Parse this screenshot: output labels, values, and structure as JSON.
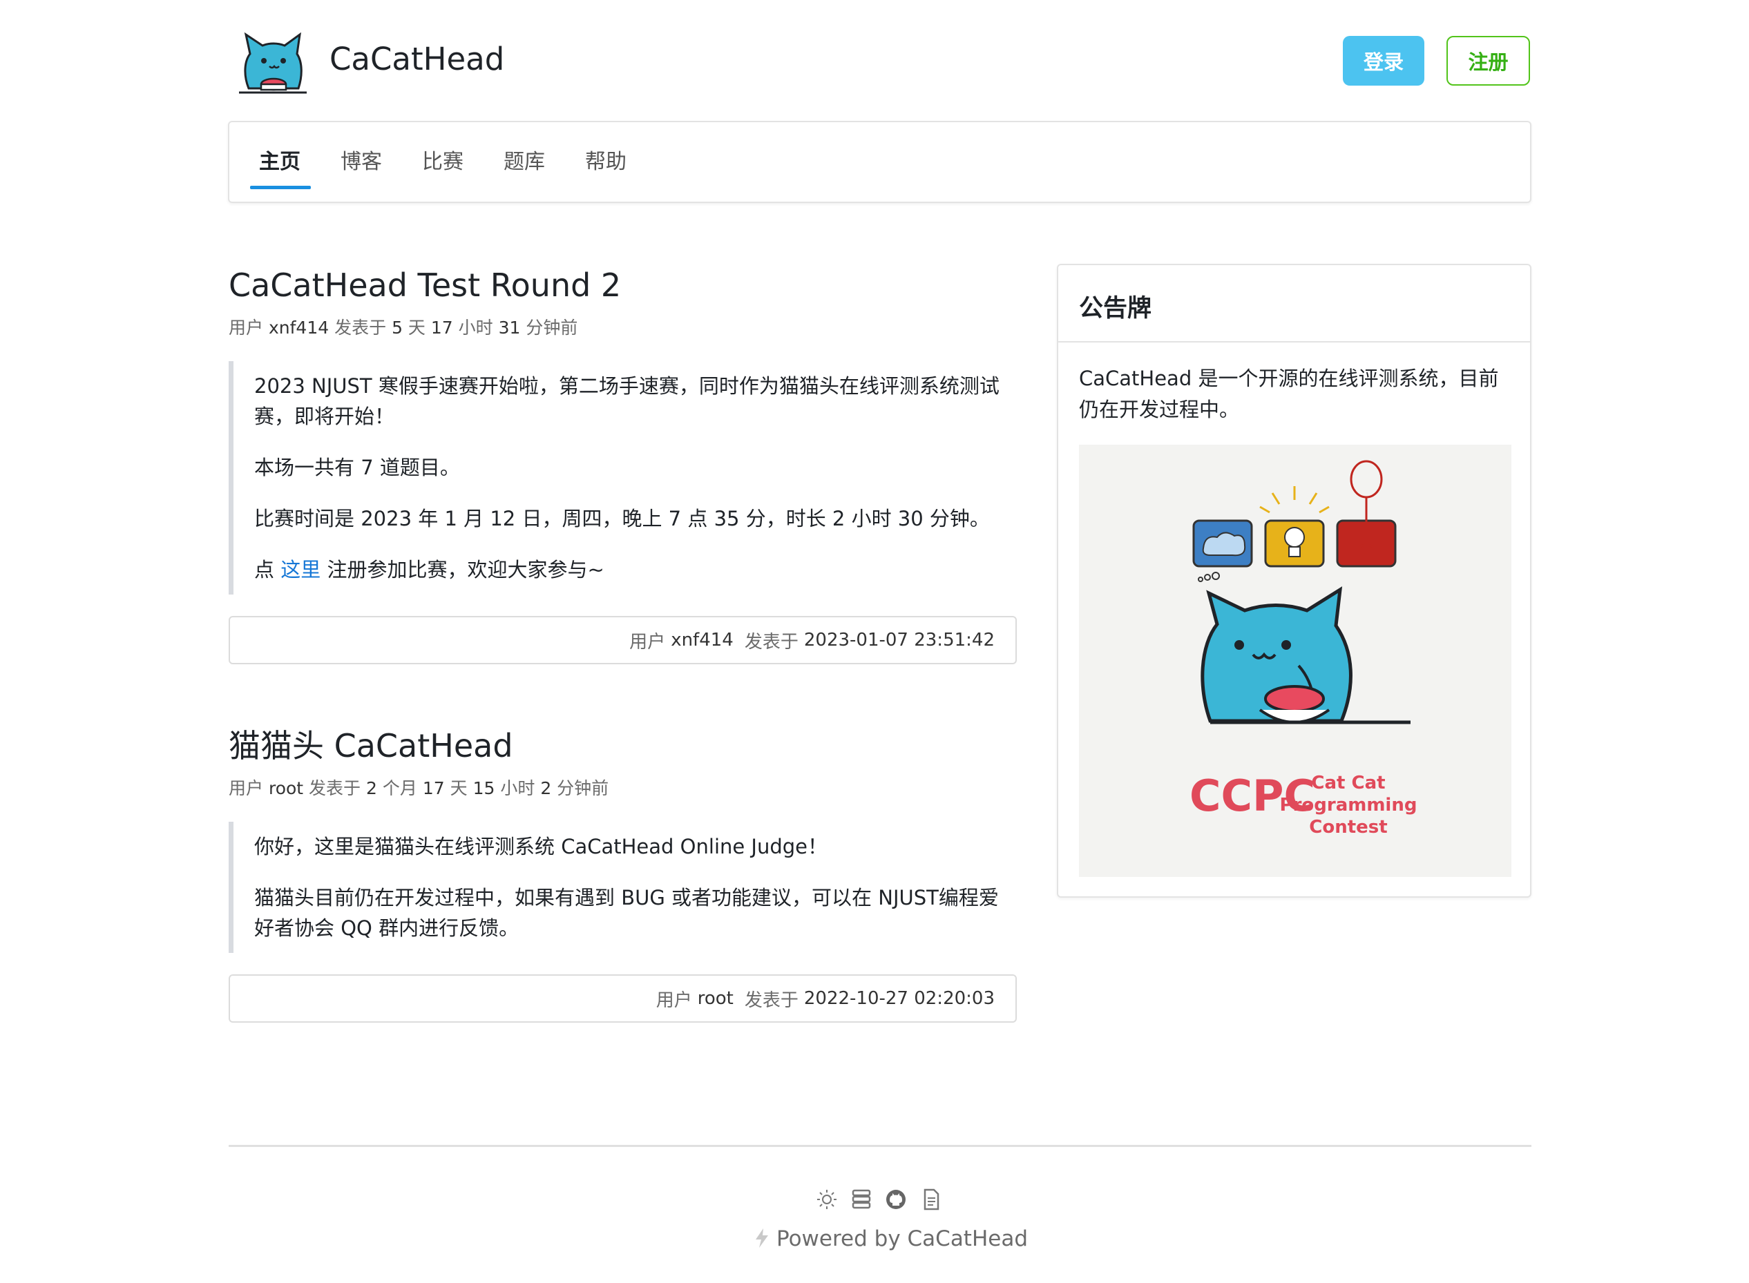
{
  "header": {
    "brand": "CaCatHead",
    "login_label": "登录",
    "register_label": "注册"
  },
  "nav": {
    "items": [
      {
        "label": "主页",
        "active": true
      },
      {
        "label": "博客"
      },
      {
        "label": "比赛"
      },
      {
        "label": "题库"
      },
      {
        "label": "帮助"
      }
    ]
  },
  "posts": [
    {
      "title": "CaCatHead Test Round 2",
      "meta": {
        "user_prefix": "用户",
        "user": "xnf414",
        "posted": "发表于",
        "n1": "5",
        "u1": "天",
        "n2": "17",
        "u2": "小时",
        "n3": "31",
        "u3": "分钟前"
      },
      "paragraphs": [
        "2023 NJUST 寒假手速赛开始啦，第二场手速赛，同时作为猫猫头在线评测系统测试",
        "赛，即将开始！",
        "本场一共有 7 道题目。",
        "比赛时间是 2023 年 1 月 12 日，周四，晚上 7 点 35 分，时长 2 小时 30 分钟。"
      ],
      "link_para": {
        "pre": "点",
        "link": "这里",
        "post": "注册参加比赛，欢迎大家参与~"
      },
      "footer": {
        "user_label": "用户",
        "user": "xnf414",
        "time_label": "发表于",
        "time": "2023-01-07 23:51:42"
      }
    },
    {
      "title": "猫猫头 CaCatHead",
      "meta": {
        "user_prefix": "用户",
        "user": "root",
        "posted": "发表于",
        "n1": "2",
        "u1": "个月",
        "n2": "17",
        "u2": "天",
        "n3": "15",
        "u3": "小时",
        "n4": "2",
        "u4": "分钟前"
      },
      "paragraphs": [
        "你好，这里是猫猫头在线评测系统 CaCatHead Online Judge！",
        "猫猫头目前仍在开发过程中，如果有遇到 BUG 或者功能建议，可以在 NJUST编程爱",
        "好者协会 QQ 群内进行反馈。"
      ],
      "footer": {
        "user_label": "用户",
        "user": "root",
        "time_label": "发表于",
        "time": "2022-10-27 02:20:03"
      }
    }
  ],
  "sidebar": {
    "title": "公告牌",
    "text_line1": "CaCatHead 是一个开源的在线评测系统，目前",
    "text_line2": "仍在开发过程中。",
    "image": {
      "logo_text": "CCPC",
      "tagline1": "Cat Cat",
      "tagline2": "Programming",
      "tagline3": "Contest"
    }
  },
  "footer": {
    "icons": [
      "sun-icon",
      "server-icon",
      "github-icon",
      "document-icon"
    ],
    "powered": "Powered by CaCatHead"
  },
  "colors": {
    "login_bg": "#4cc3f0",
    "register_border": "#52c41a",
    "nav_active": "#1a8fe0",
    "link": "#1677d6",
    "cat_body": "#3bb6d6"
  }
}
